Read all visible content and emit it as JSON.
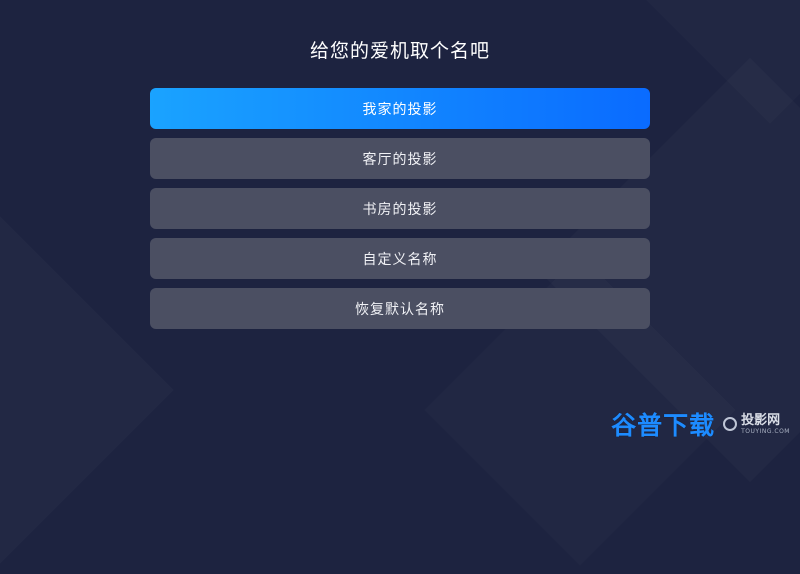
{
  "title": "给您的爱机取个名吧",
  "menu": {
    "items": [
      {
        "label": "我家的投影",
        "selected": true
      },
      {
        "label": "客厅的投影",
        "selected": false
      },
      {
        "label": "书房的投影",
        "selected": false
      },
      {
        "label": "自定义名称",
        "selected": false
      },
      {
        "label": "恢复默认名称",
        "selected": false
      }
    ]
  },
  "watermark": {
    "main": "谷普下载",
    "brand": "投影网",
    "brand_en": "TOUYING.COM"
  },
  "colors": {
    "background": "#1d2340",
    "item": "#4b4f62",
    "active_start": "#1aa3ff",
    "active_end": "#0a6bff",
    "watermark": "#1d8bff"
  }
}
